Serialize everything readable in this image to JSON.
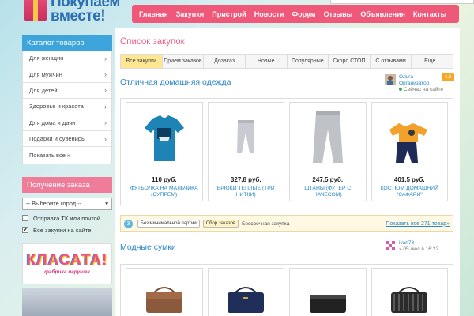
{
  "site": {
    "logo_line1": "Покупаем",
    "logo_line2": "вместе!"
  },
  "topnav": [
    "Главная",
    "Закупки",
    "Пристрой",
    "Новости",
    "Форум",
    "Отзывы",
    "Объявления",
    "Контакты"
  ],
  "catalog": {
    "title": "Каталог товаров",
    "items": [
      "Для женщин",
      "Для мужчин",
      "Для детей",
      "Здоровье и красота",
      "Для дома и дачи",
      "Подарки и сувениры",
      "Показать все »"
    ]
  },
  "order": {
    "title": "Получение заказа",
    "select_value": "-- Выберите город --",
    "option1": "Отправка ТК или почтой",
    "option2": "Все закупки на сайте",
    "option2_checked": "✔"
  },
  "banner": {
    "brand": "КЛАСАТА!",
    "tagline": "фабрика игрушек"
  },
  "main": {
    "title": "Список закупок",
    "tabs": [
      "Все закупки",
      "Прием заказов",
      "Дозаказ",
      "Новые",
      "Популярные",
      "Скоро СТОП",
      "С отзывами",
      "Еще..."
    ]
  },
  "section1": {
    "title": "Отличная домашняя одежда",
    "owner_name": "Ольга",
    "owner_role": "Организатор",
    "owner_status": "Сейчас на сайте",
    "rating": "4,5",
    "products": [
      {
        "price": "110 руб.",
        "name": "ФУТБОЛКА НА МАЛЬЧИКА (СУПРЕМ)"
      },
      {
        "price": "327,8 руб.",
        "name": "БРЮКИ ТЕПЛЫЕ (ТРИ НИТКИ)"
      },
      {
        "price": "247,5 руб.",
        "name": "ШТАНЫ (ФУТЕР С НАЧЕСОМ)"
      },
      {
        "price": "401,5 руб.",
        "name": "КОСТЮМ ДОМАШНИЙ \"САФАРИ\""
      }
    ],
    "info_num": "3",
    "pill1": "Без минимальной партии",
    "pill2": "Сбор заказов",
    "info_text": "Бессрочная закупка",
    "more_link": "Показать все 271 товар»"
  },
  "section2": {
    "title": "Модные сумки",
    "owner_name": "ivan78",
    "owner_date": "» 05 июл в 16:22"
  },
  "colors": {
    "nav_pink": "#f0587a",
    "catalog_blue": "#3ea4dc",
    "active_tab": "#ffe690",
    "link_blue": "#2a88c6"
  }
}
